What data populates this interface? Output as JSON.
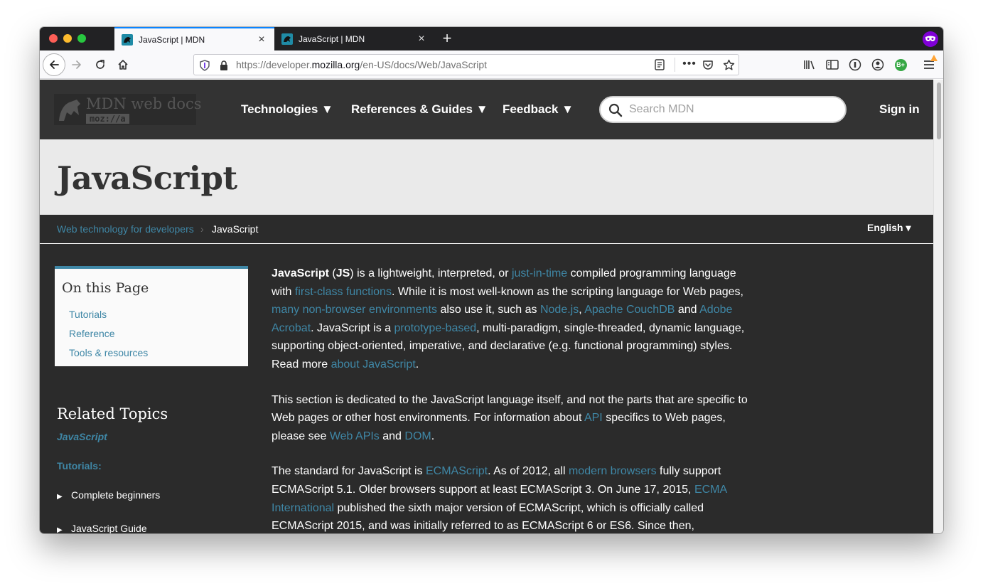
{
  "browser": {
    "tabs": [
      {
        "title": "JavaScript | MDN",
        "active": true
      },
      {
        "title": "JavaScript | MDN",
        "active": false
      }
    ],
    "new_tab_label": "+",
    "url": {
      "prefix": "https://developer.",
      "domain": "mozilla.org",
      "path": "/en-US/docs/Web/JavaScript"
    },
    "close_glyph": "×",
    "more_glyph": "•••",
    "ext_badge_label": "B+",
    "accent_color": "#0a84ff",
    "private_color": "#8000d7"
  },
  "site": {
    "logo_text": "MDN web docs",
    "logo_sub": "moz://a",
    "nav": [
      "Technologies ▼",
      "References & Guides ▼",
      "Feedback ▼"
    ],
    "search_placeholder": "Search MDN",
    "sign_in": "Sign in"
  },
  "page": {
    "title": "JavaScript",
    "breadcrumb": [
      "Web technology for developers",
      "JavaScript"
    ],
    "breadcrumb_sep": "›",
    "language": "English ▾"
  },
  "toc": {
    "heading": "On this Page",
    "items": [
      "Tutorials",
      "Reference",
      "Tools & resources"
    ]
  },
  "related": {
    "heading": "Related Topics",
    "current": "JavaScript",
    "section": "Tutorials:",
    "items": [
      "Complete beginners",
      "JavaScript Guide"
    ]
  },
  "article": {
    "p1": {
      "t1": "JavaScript",
      "t2": " (",
      "t3": "JS",
      "t4": ") is a lightweight, interpreted, or ",
      "l1": "just-in-time",
      "t5": " compiled programming language with ",
      "l2": "first-class functions",
      "t6": ". While it is most well-known as the scripting language for Web pages, ",
      "l3": "many non-browser environments",
      "t7": " also use it, such as ",
      "l4": "Node.js",
      "t8": ", ",
      "l5": "Apache CouchDB",
      "t9": " and ",
      "l6": "Adobe Acrobat",
      "t10": ". JavaScript is a ",
      "l7": "prototype-based",
      "t11": ", multi-paradigm, single-threaded, dynamic language, supporting object-oriented, imperative, and declarative (e.g. functional programming) styles. Read more ",
      "l8": "about JavaScript",
      "t12": "."
    },
    "p2": {
      "t1": "This section is dedicated to the JavaScript language itself, and not the parts that are specific to Web pages or other host environments. For information about ",
      "l1": "API",
      "t2": " specifics to Web pages, please see ",
      "l2": "Web APIs",
      "t3": " and ",
      "l3": "DOM",
      "t4": "."
    },
    "p3": {
      "t1": "The standard for JavaScript is ",
      "l1": "ECMAScript",
      "t2": ". As of 2012, all ",
      "l2": "modern browsers",
      "t3": " fully support ECMAScript 5.1. Older browsers support at least ECMAScript 3. On June 17, 2015, ",
      "l3": "ECMA International",
      "t4": " published the sixth major version of ECMAScript, which is officially called ECMAScript 2015, and was initially referred to as ECMAScript 6 or ES6. Since then,"
    },
    "link_color": "#3f87a6"
  }
}
